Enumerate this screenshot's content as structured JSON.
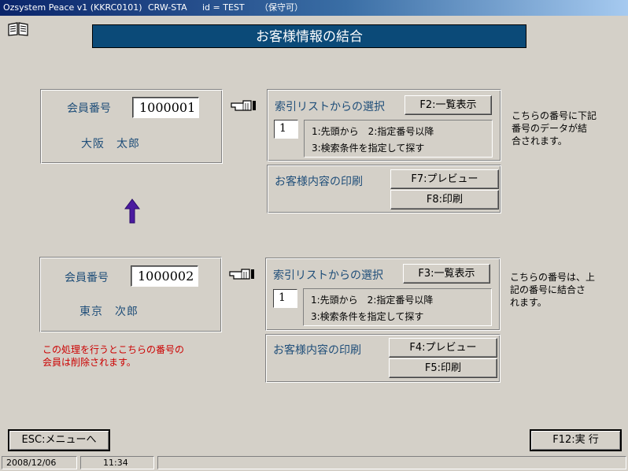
{
  "titlebar": {
    "app": "Ozsystem Peace v1 (KKRC0101)",
    "station": "CRW-STA",
    "user": "id = TEST",
    "mode": "（保守可）"
  },
  "header": {
    "title": "お客様情報の結合"
  },
  "upper": {
    "member_label": "会員番号",
    "member_number": "1000001",
    "member_name": "大阪　太郎",
    "index_select_label": "索引リストからの選択",
    "list_button": "F2:一覧表示",
    "option_value": "1",
    "option_line1": "1:先頭から　2:指定番号以降",
    "option_line2": "3:検索条件を指定して探す",
    "print_label": "お客様内容の印刷",
    "preview_button": "F7:プレビュー",
    "print_button": "F8:印刷",
    "note_line1": "こちらの番号に下記",
    "note_line2": "番号のデータが結",
    "note_line3": "合されます。"
  },
  "lower": {
    "member_label": "会員番号",
    "member_number": "1000002",
    "member_name": "東京　次郎",
    "index_select_label": "索引リストからの選択",
    "list_button": "F3:一覧表示",
    "option_value": "1",
    "option_line1": "1:先頭から　2:指定番号以降",
    "option_line2": "3:検索条件を指定して探す",
    "print_label": "お客様内容の印刷",
    "preview_button": "F4:プレビュー",
    "print_button": "F5:印刷",
    "note_line1": "こちらの番号は、上",
    "note_line2": "記の番号に結合さ",
    "note_line3": "れます。",
    "warning_line1": "この処理を行うとこちらの番号の",
    "warning_line2": "会員は削除されます。"
  },
  "footer": {
    "esc_button": "ESC:メニューへ",
    "execute_button": "F12:実 行"
  },
  "status": {
    "date": "2008/12/06",
    "time": "11:34"
  },
  "colors": {
    "title_banner": "#0b4a78",
    "label_blue": "#1f4e79",
    "warning": "#cc0000",
    "arrow": "#4b1aa0"
  }
}
